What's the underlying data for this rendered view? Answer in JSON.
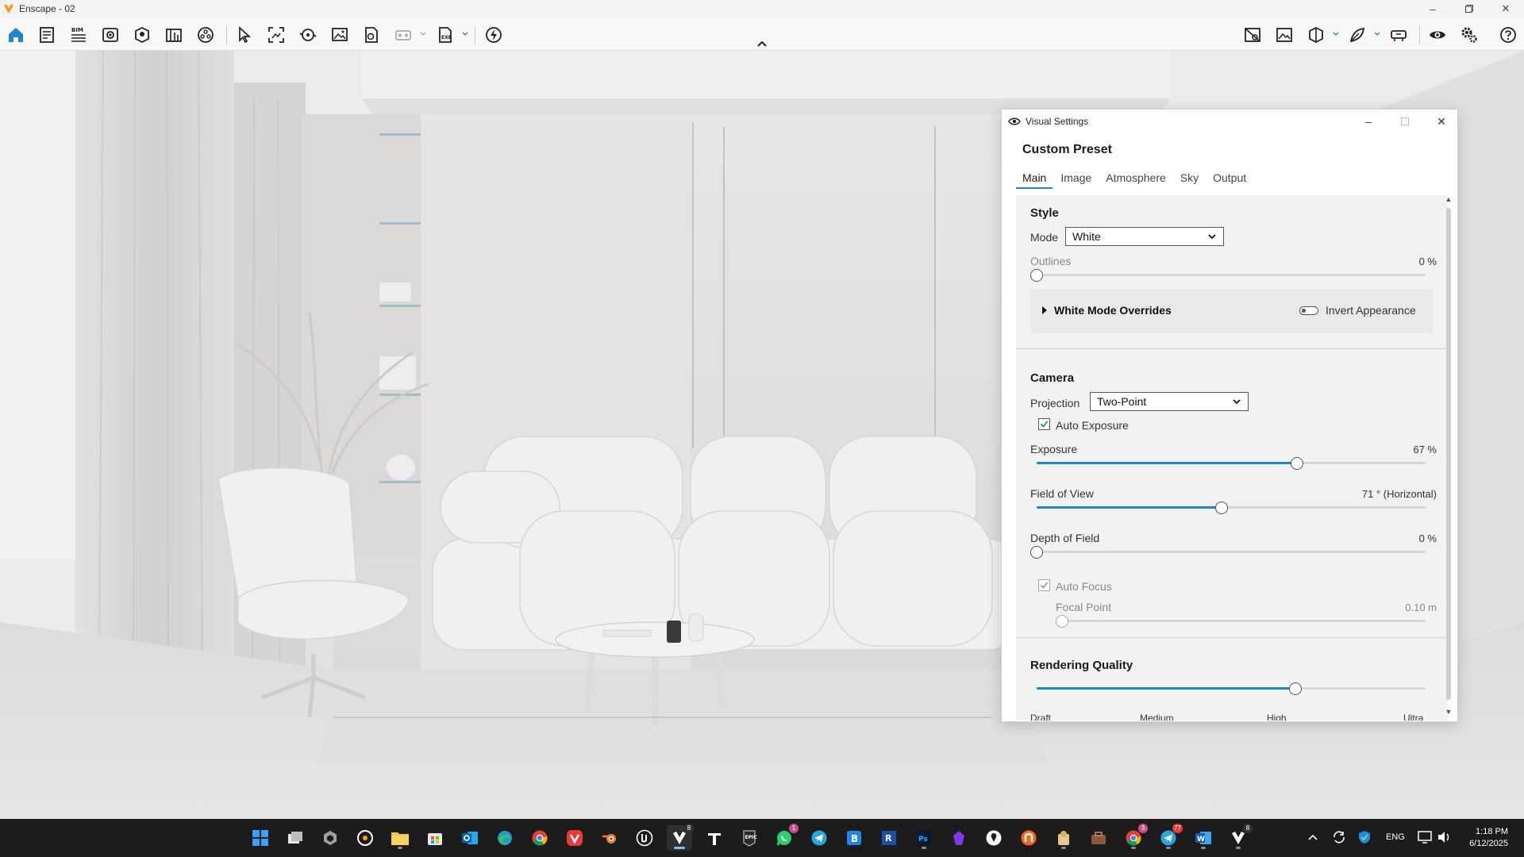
{
  "window": {
    "title": "Enscape - 02"
  },
  "colors": {
    "accent": "#1f86c9",
    "taskbar": "#1c1c1c",
    "panel_bg": "#f2f2f2"
  },
  "toolbar": {
    "left_icons": [
      "home-icon",
      "asset-library-icon",
      "bim-icon",
      "view-icon",
      "visual-settings-icon",
      "library-icon",
      "materials-icon",
      "pointer-icon",
      "screenshot-icon",
      "panorama-icon",
      "image-icon",
      "video-icon",
      "vr-icon",
      "exe-export-icon",
      "live-update-icon"
    ],
    "bim_label": "BIM",
    "right_icons": [
      "hide-ui-icon",
      "capture-icon",
      "section-icon",
      "annotation-icon",
      "vr-headset-icon",
      "eye-icon",
      "settings-icon",
      "help-icon"
    ]
  },
  "panel": {
    "title": "Visual Settings",
    "preset": "Custom Preset",
    "tabs": [
      {
        "label": "Main",
        "active": true
      },
      {
        "label": "Image",
        "active": false
      },
      {
        "label": "Atmosphere",
        "active": false
      },
      {
        "label": "Sky",
        "active": false
      },
      {
        "label": "Output",
        "active": false
      }
    ],
    "style": {
      "title": "Style",
      "mode_label": "Mode",
      "mode_value": "White",
      "outlines_label": "Outlines",
      "outlines_value": "0 %",
      "outlines_level": 0,
      "overrides_label": "White Mode Overrides",
      "invert_label": "Invert Appearance"
    },
    "camera": {
      "title": "Camera",
      "projection_label": "Projection",
      "projection_value": "Two-Point",
      "auto_exposure_label": "Auto Exposure",
      "auto_exposure_checked": true,
      "exposure_label": "Exposure",
      "exposure_value": "67 %",
      "exposure_level": 0.67,
      "fov_label": "Field of View",
      "fov_value": "71 ° (Horizontal)",
      "fov_level": 0.475,
      "dof_label": "Depth of Field",
      "dof_value": "0 %",
      "dof_level": 0,
      "auto_focus_label": "Auto Focus",
      "auto_focus_checked": true,
      "focal_point_label": "Focal Point",
      "focal_point_value": "0.10 m",
      "focal_level": 0
    },
    "quality": {
      "title": "Rendering Quality",
      "level": 0.665,
      "labels": [
        "Draft",
        "Medium",
        "High",
        "Ultra"
      ]
    }
  },
  "taskbar": {
    "apps": [
      "windows-start-icon",
      "task-view-icon",
      "unity-hub-icon",
      "cinema-app-icon",
      "file-explorer-icon",
      "microsoft-store-icon",
      "outlook-icon",
      "edge-icon",
      "chrome-icon",
      "vivaldi-icon",
      "blender-icon",
      "unreal-engine-icon",
      "enscape-icon",
      "typora-icon",
      "epic-games-icon",
      "whatsapp-icon",
      "telegram-icon",
      "b-app-icon",
      "revit-icon",
      "photoshop-icon",
      "obsidian-icon",
      "maps-icon",
      "d5-render-icon",
      "files-app-icon",
      "toolbox-icon",
      "chrome-profile-icon",
      "telegram-alt-icon",
      "word-icon",
      "enscape-alt-icon"
    ],
    "whatsapp_badge": "1",
    "telegram_badge": "77",
    "chrome_badge": "3",
    "enscape_badge": "8",
    "enscape_alt_badge": "8",
    "lang": "ENG",
    "time": "1:18 PM",
    "date": "6/12/2025"
  }
}
